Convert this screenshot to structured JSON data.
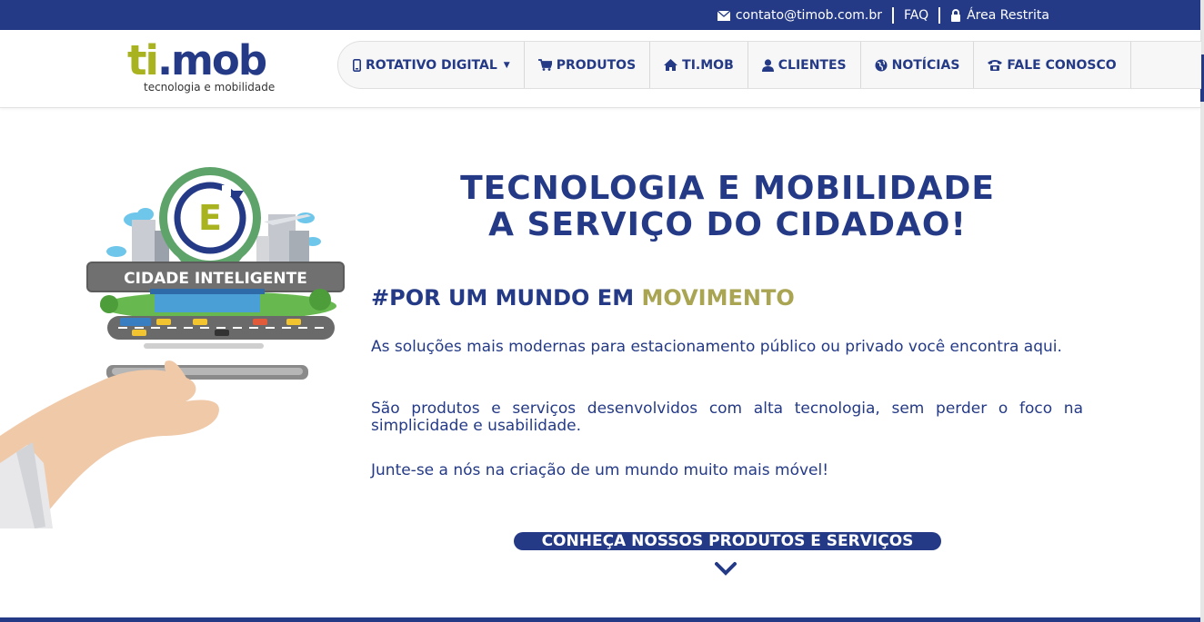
{
  "topbar": {
    "email": "contato@timob.com.br",
    "faq": "FAQ",
    "restricted": "Área Restrita"
  },
  "logo": {
    "ti": "ti",
    "mob": ".mob",
    "tagline": "tecnologia e mobilidade"
  },
  "nav": {
    "items": [
      {
        "label": "ROTATIVO DIGITAL",
        "icon": "mobile-phone-icon"
      },
      {
        "label": "PRODUTOS",
        "icon": "shopping-cart-icon"
      },
      {
        "label": "TI.MOB",
        "icon": "home-icon"
      },
      {
        "label": "CLIENTES",
        "icon": "user-icon"
      },
      {
        "label": "NOTÍCIAS",
        "icon": "globe-icon"
      },
      {
        "label": "FALE CONOSCO",
        "icon": "phone-icon"
      }
    ]
  },
  "hero": {
    "badge_label": "CIDADE INTELIGENTE",
    "badge_letter": "E",
    "headline_line1": "TECNOLOGIA E MOBILIDADE",
    "headline_line2": "A SERVIÇO DO CIDADAO!",
    "hashtag_main": "#POR UM MUNDO EM ",
    "hashtag_accent": "MOVIMENTO",
    "paragraph1": "As soluções mais modernas para estacionamento público ou privado você encontra aqui.",
    "paragraph2": "São produtos e serviços desenvolvidos com alta tecnologia, sem perder o foco na simplicidade e usabilidade.",
    "paragraph3": "Junte-se a nós na criação de um mundo muito mais móvel!",
    "cta_label": "CONHEÇA NOSSOS PRODUTOS E SERVIÇOS"
  },
  "colors": {
    "primary": "#243a86",
    "brand_green": "#a9b21f",
    "accent_olive": "#a9a552"
  }
}
